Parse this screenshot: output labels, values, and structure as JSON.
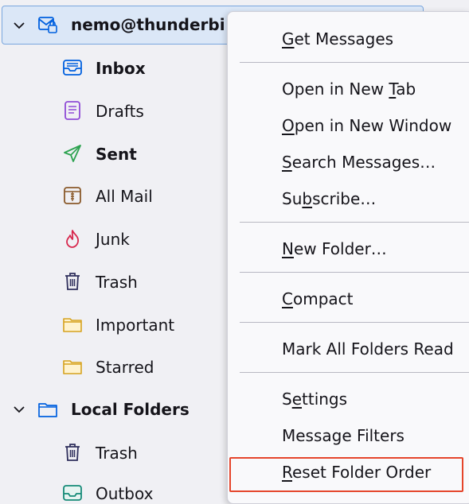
{
  "account": {
    "name": "nemo@thunderbird.net"
  },
  "folders": [
    {
      "label": "Inbox",
      "bold": true,
      "icon": "inbox-icon"
    },
    {
      "label": "Drafts",
      "bold": false,
      "icon": "drafts-icon"
    },
    {
      "label": "Sent",
      "bold": true,
      "icon": "sent-icon"
    },
    {
      "label": "All Mail",
      "bold": false,
      "icon": "archive-icon"
    },
    {
      "label": "Junk",
      "bold": false,
      "icon": "junk-icon"
    },
    {
      "label": "Trash",
      "bold": false,
      "icon": "trash-icon"
    },
    {
      "label": "Important",
      "bold": false,
      "icon": "folder-icon"
    },
    {
      "label": "Starred",
      "bold": false,
      "icon": "folder-icon"
    }
  ],
  "local": {
    "name": "Local Folders",
    "folders": [
      {
        "label": "Trash",
        "icon": "trash-icon"
      },
      {
        "label": "Outbox",
        "icon": "outbox-icon"
      }
    ]
  },
  "menu": {
    "items": [
      {
        "pre": "",
        "key": "G",
        "post": "et Messages"
      },
      {
        "pre": "Open in New ",
        "key": "T",
        "post": "ab"
      },
      {
        "pre": "",
        "key": "O",
        "post": "pen in New Window"
      },
      {
        "pre": "",
        "key": "S",
        "post": "earch Messages…"
      },
      {
        "pre": "Su",
        "key": "b",
        "post": "scribe…"
      },
      {
        "pre": "",
        "key": "N",
        "post": "ew Folder…"
      },
      {
        "pre": "",
        "key": "C",
        "post": "ompact"
      },
      {
        "pre": "Mark All Folders Read",
        "key": "",
        "post": ""
      },
      {
        "pre": "S",
        "key": "e",
        "post": "ttings"
      },
      {
        "pre": "Message Filters",
        "key": "",
        "post": ""
      },
      {
        "pre": "",
        "key": "R",
        "post": "eset Folder Order"
      }
    ]
  },
  "colors": {
    "accent": "#0060df",
    "highlight": "#e5452b",
    "selection": "#dbe7f7"
  }
}
